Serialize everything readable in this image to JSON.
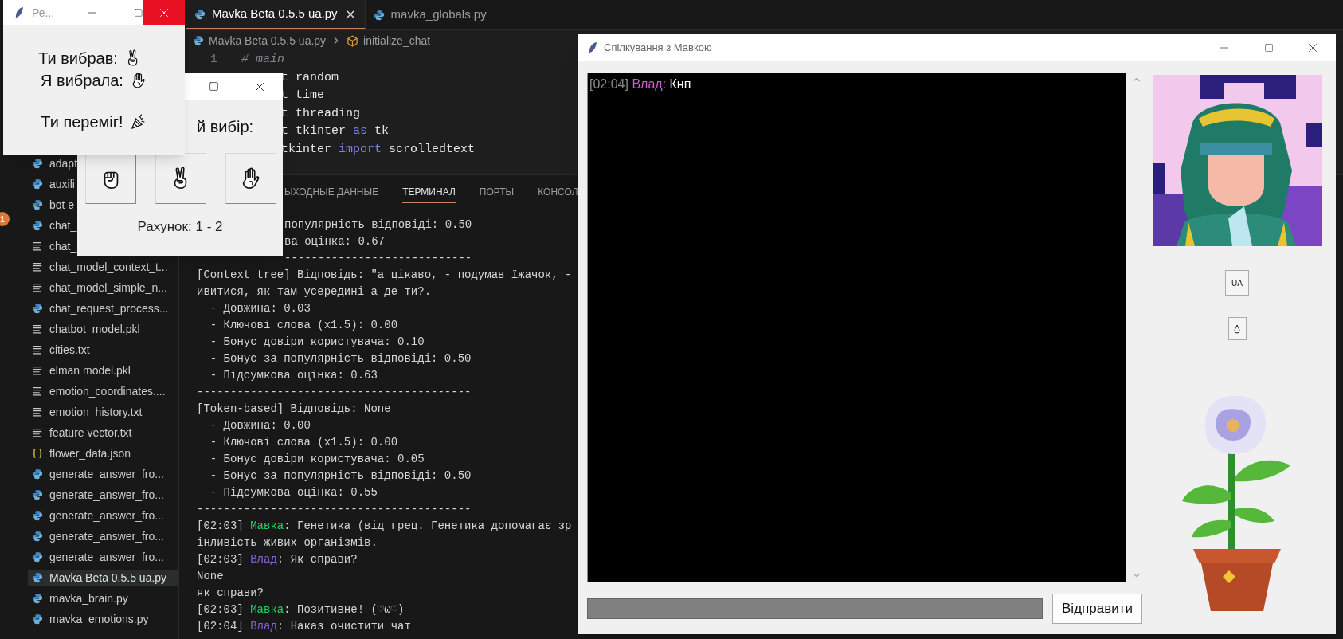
{
  "vscode": {
    "activity_badge": "1",
    "explorer_items": [
      {
        "label": "adapt",
        "kind": "python",
        "selected": false
      },
      {
        "label": "auxili",
        "kind": "python",
        "selected": false
      },
      {
        "label": "bot e",
        "kind": "python",
        "selected": false
      },
      {
        "label": "chat_",
        "kind": "python",
        "selected": false
      },
      {
        "label": "chat_",
        "kind": "text",
        "selected": false
      },
      {
        "label": "chat_model_context_t...",
        "kind": "text",
        "selected": false
      },
      {
        "label": "chat_model_simple_n...",
        "kind": "text",
        "selected": false
      },
      {
        "label": "chat_request_process...",
        "kind": "python",
        "selected": false
      },
      {
        "label": "chatbot_model.pkl",
        "kind": "text",
        "selected": false
      },
      {
        "label": "cities.txt",
        "kind": "text",
        "selected": false
      },
      {
        "label": "elman model.pkl",
        "kind": "text",
        "selected": false
      },
      {
        "label": "emotion_coordinates....",
        "kind": "text",
        "selected": false
      },
      {
        "label": "emotion_history.txt",
        "kind": "text",
        "selected": false
      },
      {
        "label": "feature vector.txt",
        "kind": "text",
        "selected": false
      },
      {
        "label": "flower_data.json",
        "kind": "json",
        "selected": false
      },
      {
        "label": "generate_answer_fro...",
        "kind": "python",
        "selected": false
      },
      {
        "label": "generate_answer_fro...",
        "kind": "python",
        "selected": false
      },
      {
        "label": "generate_answer_fro...",
        "kind": "python",
        "selected": false
      },
      {
        "label": "generate_answer_fro...",
        "kind": "python",
        "selected": false
      },
      {
        "label": "generate_answer_fro...",
        "kind": "python",
        "selected": false
      },
      {
        "label": "Mavka Beta 0.5.5 ua.py",
        "kind": "python",
        "selected": true
      },
      {
        "label": "mavka_brain.py",
        "kind": "python",
        "selected": false
      },
      {
        "label": "mavka_emotions.py",
        "kind": "python",
        "selected": false
      }
    ],
    "tabs": [
      {
        "label": "Mavka Beta 0.5.5 ua.py",
        "selected": true
      },
      {
        "label": "mavka_globals.py",
        "selected": false
      }
    ],
    "breadcrumb": {
      "file": "Mavka Beta 0.5.5 ua.py",
      "symbol": "initialize_chat"
    },
    "code_lines": [
      {
        "number": "1",
        "kind": "full",
        "segments": [
          {
            "text": "# main",
            "kind": "comment"
          }
        ]
      },
      {
        "kind": "partial",
        "segments": [
          {
            "text": "t random",
            "kind": "plain"
          }
        ]
      },
      {
        "kind": "partial",
        "segments": [
          {
            "text": "t time",
            "kind": "plain"
          }
        ]
      },
      {
        "kind": "partial",
        "segments": [
          {
            "text": "t threading",
            "kind": "plain"
          }
        ]
      },
      {
        "kind": "partial",
        "segments": [
          {
            "text": "t tkinter ",
            "kind": "plain"
          },
          {
            "text": "as",
            "kind": "keyword"
          },
          {
            "text": " tk",
            "kind": "plain"
          }
        ]
      },
      {
        "kind": "partial",
        "segments": [
          {
            "text": "tkinter ",
            "kind": "plain"
          },
          {
            "text": "import",
            "kind": "keyword"
          },
          {
            "text": " scrolledtext",
            "kind": "plain"
          }
        ]
      }
    ],
    "panel_tabs": [
      {
        "label": "ЫХОДНЫЕ ДАННЫЕ",
        "selected": false
      },
      {
        "label": "ТЕРМИНАЛ",
        "selected": true
      },
      {
        "label": "ПОРТЫ",
        "selected": false
      },
      {
        "label": "КОНСОЛ",
        "selected": false
      }
    ],
    "terminal_lines": [
      {
        "kind": "partial",
        "text": "популярність відповіді: 0.50"
      },
      {
        "kind": "partial",
        "text": "ва оцінка: 0.67"
      },
      {
        "kind": "partial",
        "text": "----------------------------"
      },
      {
        "kind": "plain",
        "text": "[Context tree] Відповідь: \"а цікаво, - подумав їжачок, -"
      },
      {
        "kind": "plain",
        "text": "ивитися, як там усередині а де ти?."
      },
      {
        "kind": "plain",
        "text": "  - Довжина: 0.03"
      },
      {
        "kind": "plain",
        "text": "  - Ключові слова (x1.5): 0.00"
      },
      {
        "kind": "plain",
        "text": "  - Бонус довіри користувача: 0.10"
      },
      {
        "kind": "plain",
        "text": "  - Бонус за популярність відповіді: 0.50"
      },
      {
        "kind": "plain",
        "text": "  - Підсумкова оцінка: 0.63"
      },
      {
        "kind": "plain",
        "text": "-----------------------------------------"
      },
      {
        "kind": "plain",
        "text": "[Token-based] Відповідь: None"
      },
      {
        "kind": "plain",
        "text": "  - Довжина: 0.00"
      },
      {
        "kind": "plain",
        "text": "  - Ключові слова (x1.5): 0.00"
      },
      {
        "kind": "plain",
        "text": "  - Бонус довіри користувача: 0.05"
      },
      {
        "kind": "plain",
        "text": "  - Бонус за популярність відповіді: 0.50"
      },
      {
        "kind": "plain",
        "text": "  - Підсумкова оцінка: 0.55"
      },
      {
        "kind": "plain",
        "text": "-----------------------------------------"
      },
      {
        "kind": "chat",
        "time": "[02:03]",
        "speaker": "Мавка",
        "color": "#23d160",
        "text": ": Генетика (від грец. Генетика допомагає зр"
      },
      {
        "kind": "plain",
        "text": "інливість живих організмів."
      },
      {
        "kind": "chat",
        "time": "[02:03]",
        "speaker": "Влад",
        "color": "#8a5fd6",
        "text": ": Як справи?"
      },
      {
        "kind": "plain",
        "text": "None"
      },
      {
        "kind": "plain",
        "text": "як справи?"
      },
      {
        "kind": "chat",
        "time": "[02:03]",
        "speaker": "Мавка",
        "color": "#23d160",
        "text": ": Позитивне! (♡ω♡)"
      },
      {
        "kind": "chat",
        "time": "[02:04]",
        "speaker": "Влад",
        "color": "#8a5fd6",
        "text": ": Наказ очистити чат"
      }
    ]
  },
  "rps_choice_window": {
    "prompt": "й вибір:",
    "choices": [
      {
        "kind": "fist"
      },
      {
        "kind": "peace"
      },
      {
        "kind": "open"
      }
    ],
    "score": "Рахунок: 1 - 2"
  },
  "rps_result_window": {
    "title": "Ре...",
    "lines": [
      {
        "text": "Ти вибрав:",
        "kind": "peace"
      },
      {
        "text": "Я вибрала:",
        "kind": "open"
      },
      {
        "text": "Ти переміг!",
        "kind": "party"
      }
    ]
  },
  "chat_window": {
    "title": "Спілкування з Мавкою",
    "messages": [
      {
        "time": "[02:04]",
        "speaker": "Влад:",
        "color": "#cc5fcf",
        "text": "Кнп"
      }
    ],
    "language_button": "UA",
    "send_button": "Відправити"
  }
}
